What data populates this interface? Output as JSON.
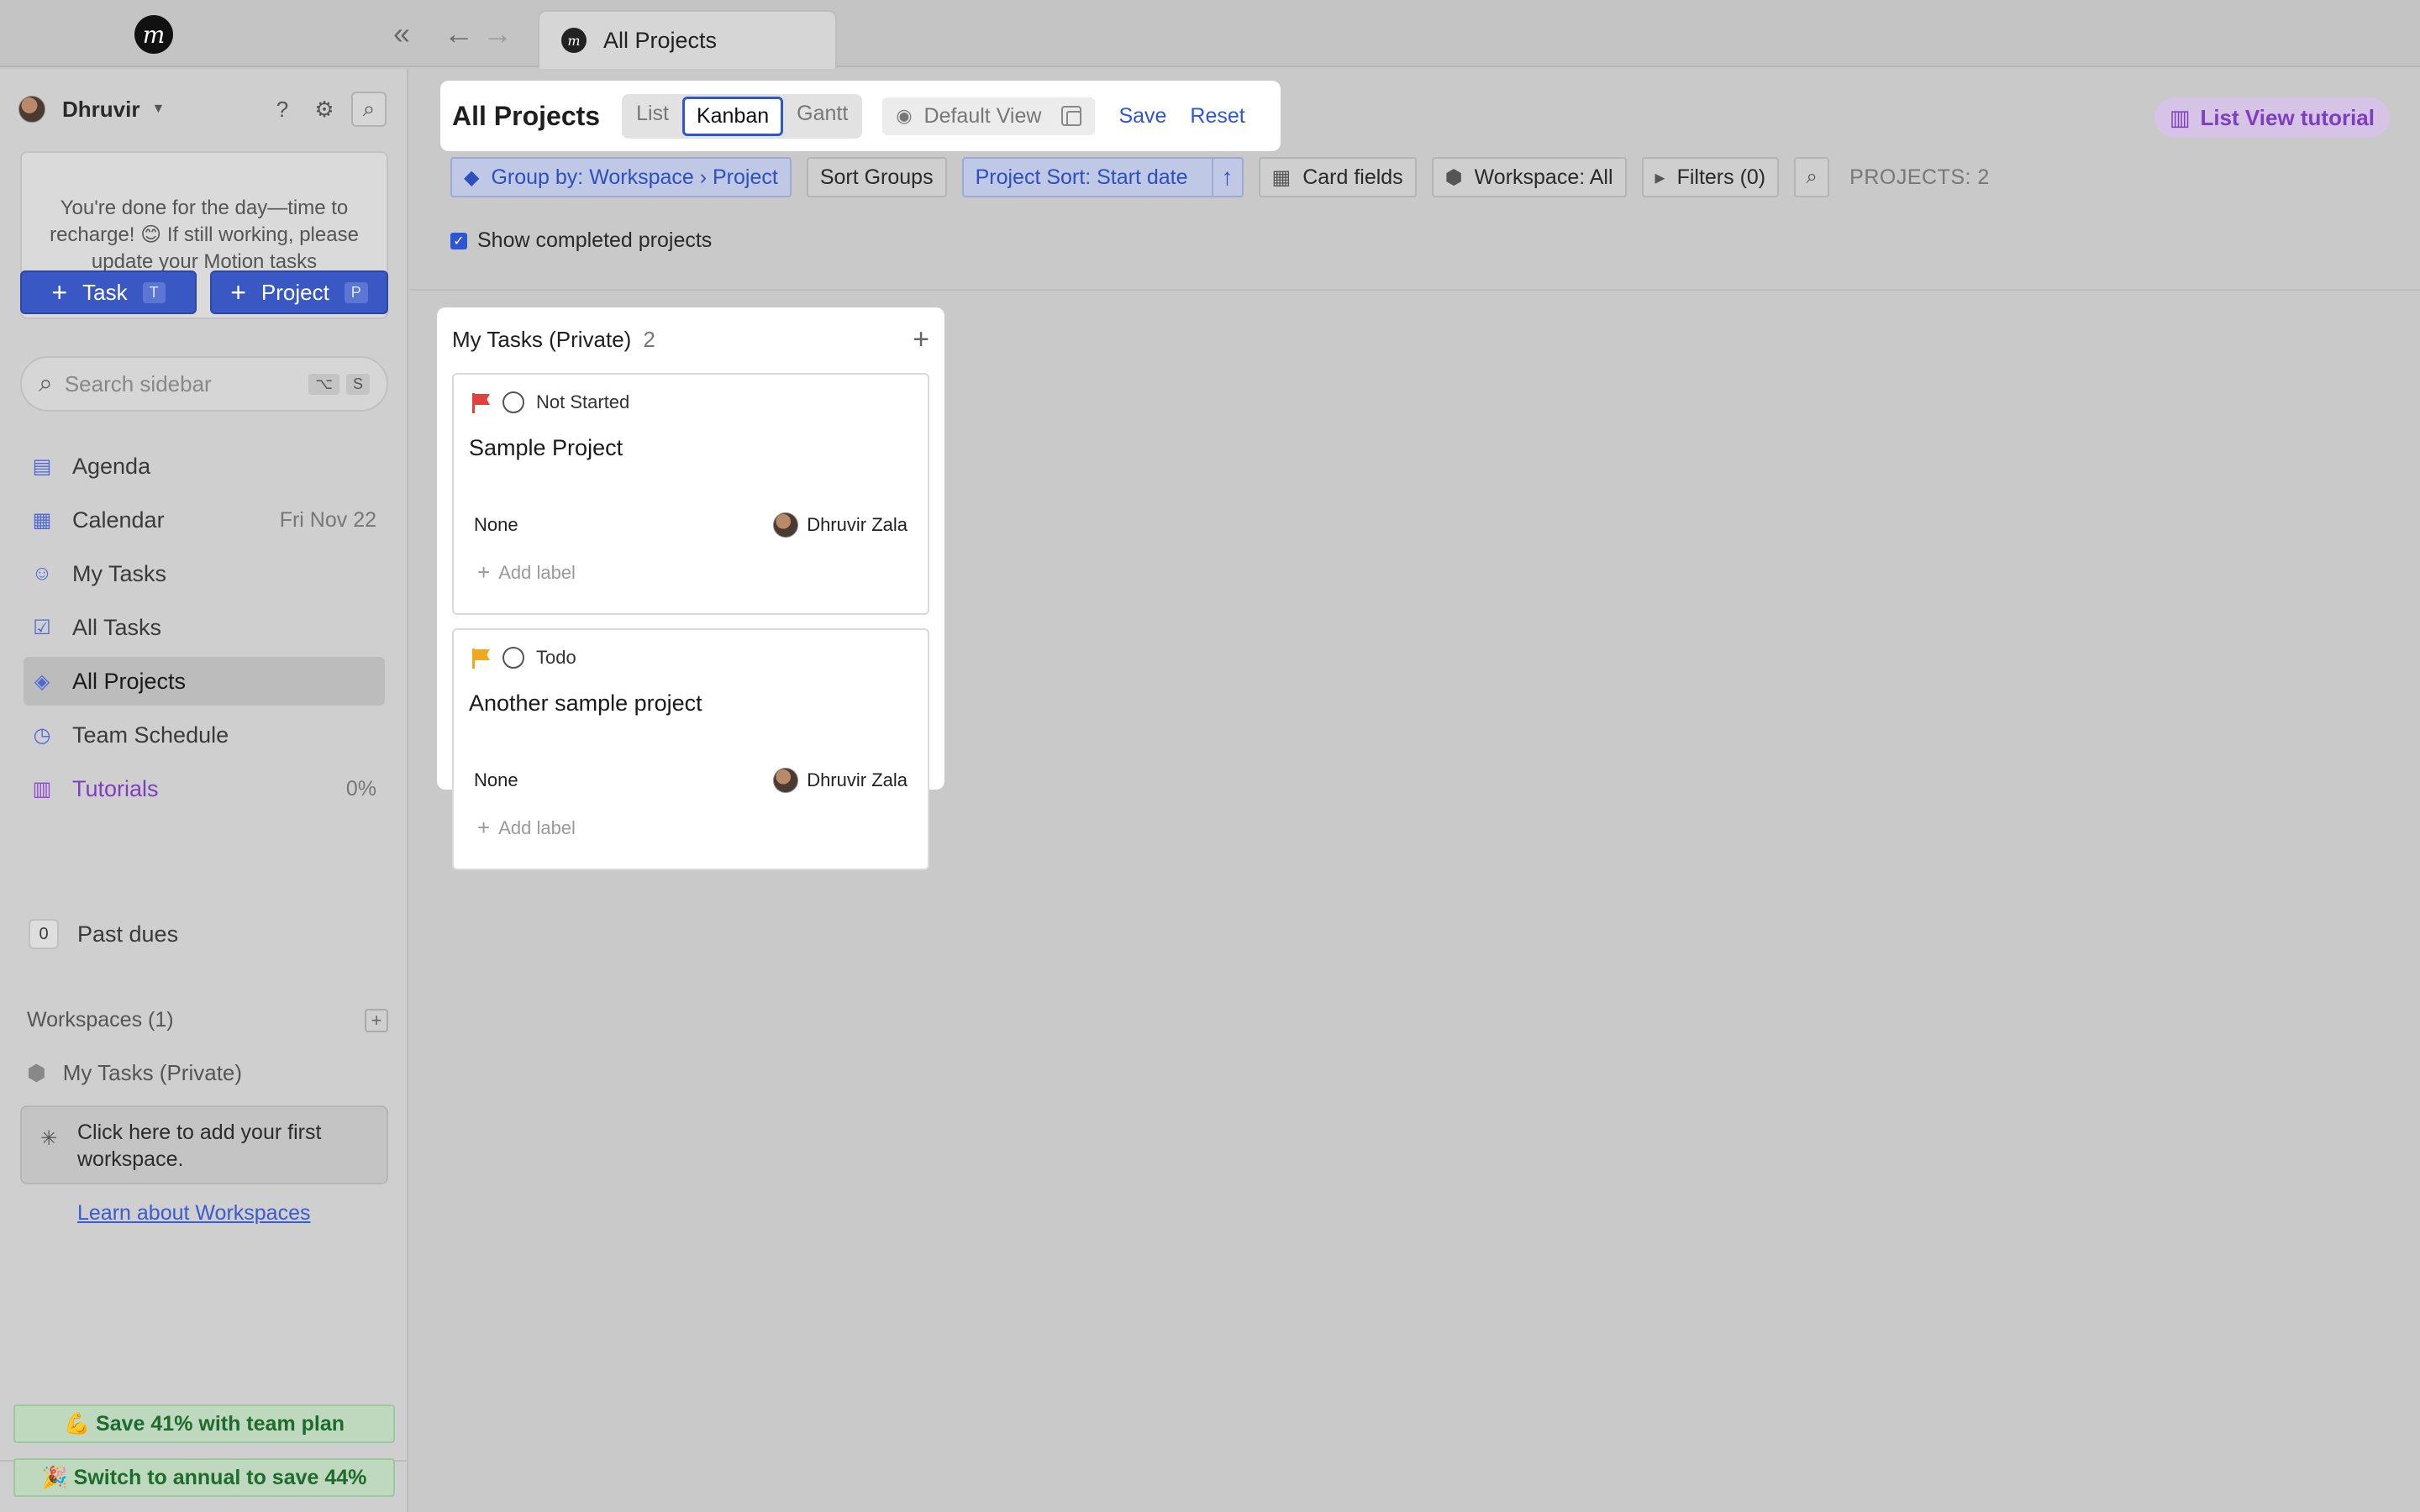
{
  "window": {
    "tab_title": "All Projects"
  },
  "sidebar": {
    "user_name": "Dhruvir",
    "notice": "You're done for the day—time to recharge! 😊 If still working, please update your Motion tasks",
    "task_button": "Task",
    "task_shortcut": "T",
    "project_button": "Project",
    "project_shortcut": "P",
    "search_placeholder": "Search sidebar",
    "search_keys": [
      "⌥",
      "S"
    ],
    "nav": [
      {
        "label": "Agenda",
        "icon": "agenda-icon"
      },
      {
        "label": "Calendar",
        "icon": "calendar-icon",
        "right": "Fri Nov 22"
      },
      {
        "label": "My Tasks",
        "icon": "my-tasks-icon"
      },
      {
        "label": "All Tasks",
        "icon": "all-tasks-icon"
      },
      {
        "label": "All Projects",
        "icon": "all-projects-icon",
        "active": true
      },
      {
        "label": "Team Schedule",
        "icon": "team-schedule-icon"
      },
      {
        "label": "Tutorials",
        "icon": "tutorials-icon",
        "right": "0%"
      }
    ],
    "past_dues_count": "0",
    "past_dues_label": "Past dues",
    "workspaces_heading": "Workspaces (1)",
    "workspace_item": "My Tasks (Private)",
    "workspace_callout": "Click here to add your first workspace.",
    "learn_link": "Learn about Workspaces",
    "promo_team": "💪 Save 41% with team plan",
    "promo_annual": "🎉 Switch to annual to save 44%"
  },
  "main": {
    "title": "All Projects",
    "views": [
      "List",
      "Kanban",
      "Gantt"
    ],
    "active_view": "Kanban",
    "default_view": "Default View",
    "save": "Save",
    "reset": "Reset",
    "tutorial": "List View tutorial",
    "toolbar": {
      "group_by": "Group by: Workspace › Project",
      "sort_groups": "Sort Groups",
      "project_sort": "Project Sort: Start date",
      "card_fields": "Card fields",
      "workspace": "Workspace: All",
      "filters": "Filters (0)",
      "projects_count": "PROJECTS: 2"
    },
    "show_completed": "Show completed projects",
    "show_completed_checked": true
  },
  "column": {
    "title": "My Tasks (Private)",
    "count": "2",
    "cards": [
      {
        "status": "Not Started",
        "priority_color": "#e0413d",
        "title": "Sample Project",
        "field": "None",
        "owner": "Dhruvir Zala",
        "add_label": "Add label"
      },
      {
        "status": "Todo",
        "priority_color": "#f0a820",
        "title": "Another sample project",
        "field": "None",
        "owner": "Dhruvir Zala",
        "add_label": "Add label"
      }
    ]
  },
  "colors": {
    "accent": "#2e56d4",
    "primary_button": "#3a58c4",
    "tutorial": "#7c3fbe"
  }
}
